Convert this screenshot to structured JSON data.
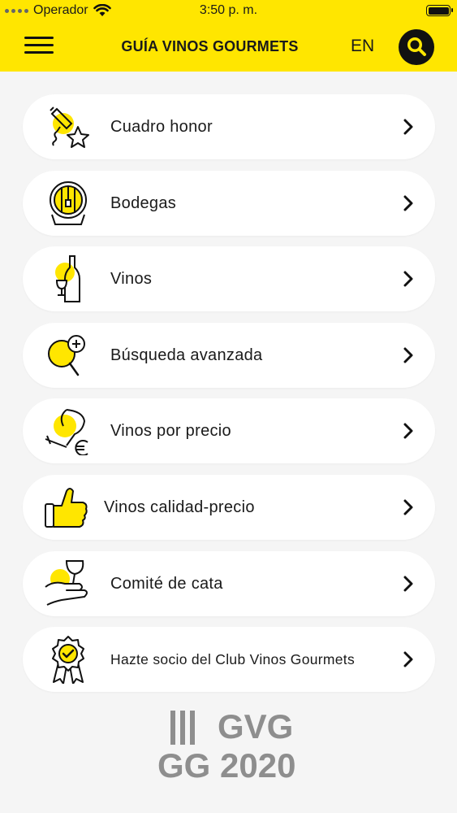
{
  "status_bar": {
    "carrier": "Operador",
    "time": "3:50 p. m."
  },
  "header": {
    "title": "GUÍA VINOS GOURMETS",
    "language": "EN",
    "icons": [
      "menu-icon",
      "search-icon"
    ]
  },
  "menu": {
    "items": [
      {
        "label": "Cuadro honor",
        "icon": "corkscrew-star-icon"
      },
      {
        "label": "Bodegas",
        "icon": "barrel-icon"
      },
      {
        "label": "Vinos",
        "icon": "wine-bottle-icon"
      },
      {
        "label": "Búsqueda avanzada",
        "icon": "magnifier-plus-icon"
      },
      {
        "label": "Vinos por precio",
        "icon": "glass-euro-icon"
      },
      {
        "label": "Vinos calidad-precio",
        "icon": "thumbs-up-icon"
      },
      {
        "label": "Comité de cata",
        "icon": "hand-glass-icon"
      },
      {
        "label": "Hazte socio del Club Vinos Gourmets",
        "icon": "award-badge-icon"
      }
    ],
    "chevron_icon": "chevron-right-icon"
  },
  "footer": {
    "logo_line1": "GVG",
    "logo_line2": "GG 2020"
  },
  "colors": {
    "accent": "#ffe600",
    "background": "#f5f5f5",
    "card": "#ffffff",
    "text": "#1a1a1a",
    "logo": "#8e8e8e"
  }
}
